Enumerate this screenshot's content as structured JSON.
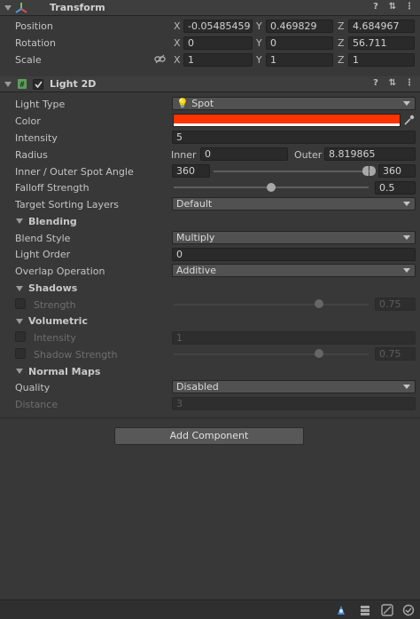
{
  "transform": {
    "title": "Transform",
    "position": {
      "label": "Position",
      "x": "-0.05485459",
      "y": "0.469829",
      "z": "4.684967"
    },
    "rotation": {
      "label": "Rotation",
      "x": "0",
      "y": "0",
      "z": "56.711"
    },
    "scale": {
      "label": "Scale",
      "x": "1",
      "y": "1",
      "z": "1"
    },
    "axes": {
      "x": "X",
      "y": "Y",
      "z": "Z"
    }
  },
  "light2d": {
    "title": "Light 2D",
    "light_type": {
      "label": "Light Type",
      "value": "Spot"
    },
    "color": {
      "label": "Color",
      "value": "#ff3300"
    },
    "intensity": {
      "label": "Intensity",
      "value": "5"
    },
    "radius": {
      "label": "Radius",
      "inner_label": "Inner",
      "inner": "0",
      "outer_label": "Outer",
      "outer": "8.819865"
    },
    "spot_angle": {
      "label": "Inner / Outer Spot Angle",
      "inner": "360",
      "outer": "360"
    },
    "falloff": {
      "label": "Falloff Strength",
      "value": "0.5"
    },
    "sorting": {
      "label": "Target Sorting Layers",
      "value": "Default"
    },
    "blending": {
      "title": "Blending",
      "blend_style": {
        "label": "Blend Style",
        "value": "Multiply"
      },
      "light_order": {
        "label": "Light Order",
        "value": "0"
      },
      "overlap": {
        "label": "Overlap Operation",
        "value": "Additive"
      }
    },
    "shadows": {
      "title": "Shadows",
      "strength": {
        "label": "Strength",
        "value": "0.75"
      }
    },
    "volumetric": {
      "title": "Volumetric",
      "intensity": {
        "label": "Intensity",
        "value": "1"
      },
      "shadow_strength": {
        "label": "Shadow Strength",
        "value": "0.75"
      }
    },
    "normal_maps": {
      "title": "Normal Maps",
      "quality": {
        "label": "Quality",
        "value": "Disabled"
      },
      "distance": {
        "label": "Distance",
        "value": "3"
      }
    }
  },
  "add_component": "Add Component"
}
